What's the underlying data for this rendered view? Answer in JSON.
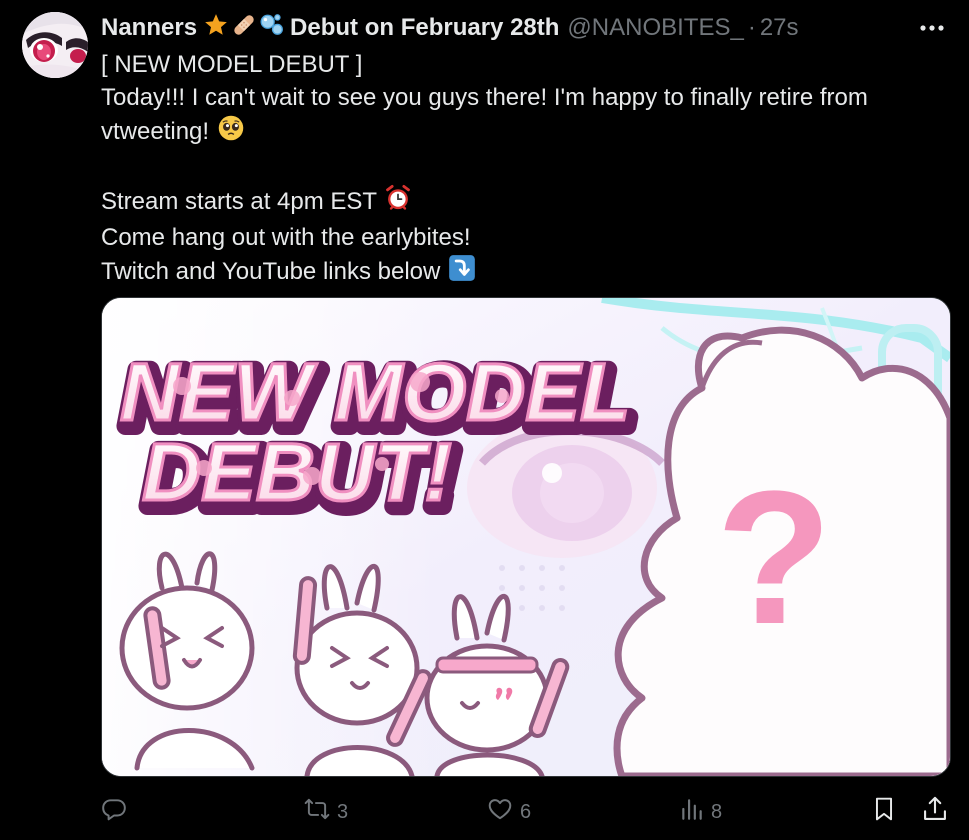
{
  "tweet": {
    "display_name": "Nanners",
    "name_suffix": "Debut on February 28th",
    "handle": "@NANOBITES_",
    "separator": "·",
    "time": "27s",
    "lines": [
      "[ NEW MODEL DEBUT ]",
      "Today!!! I can't wait to see you guys there! I'm happy to finally retire from",
      "vtweeting!",
      "",
      "Stream starts at 4pm EST",
      "Come hang out with the earlybites!",
      "Twitch and YouTube links below"
    ],
    "image": {
      "title_line1": "NEW MODEL",
      "title_line2": "DEBUT!",
      "mark": "?"
    }
  },
  "actions": {
    "replies": "",
    "reposts": "3",
    "likes": "6",
    "views": "8"
  },
  "icons": {
    "name_emojis": [
      "star-emoji",
      "bandage-emoji",
      "bubbles-emoji"
    ],
    "more": "more-horizontal-icon",
    "reply": "reply-icon",
    "repost": "repost-icon",
    "like": "heart-icon",
    "views": "views-icon",
    "bookmark": "bookmark-icon",
    "share": "share-icon"
  },
  "colors": {
    "background": "#000000",
    "text": "#e7e9ea",
    "secondary": "#71767b",
    "border": "#2f3336",
    "pink": "#f59bc4",
    "purple": "#7a2a6e"
  }
}
